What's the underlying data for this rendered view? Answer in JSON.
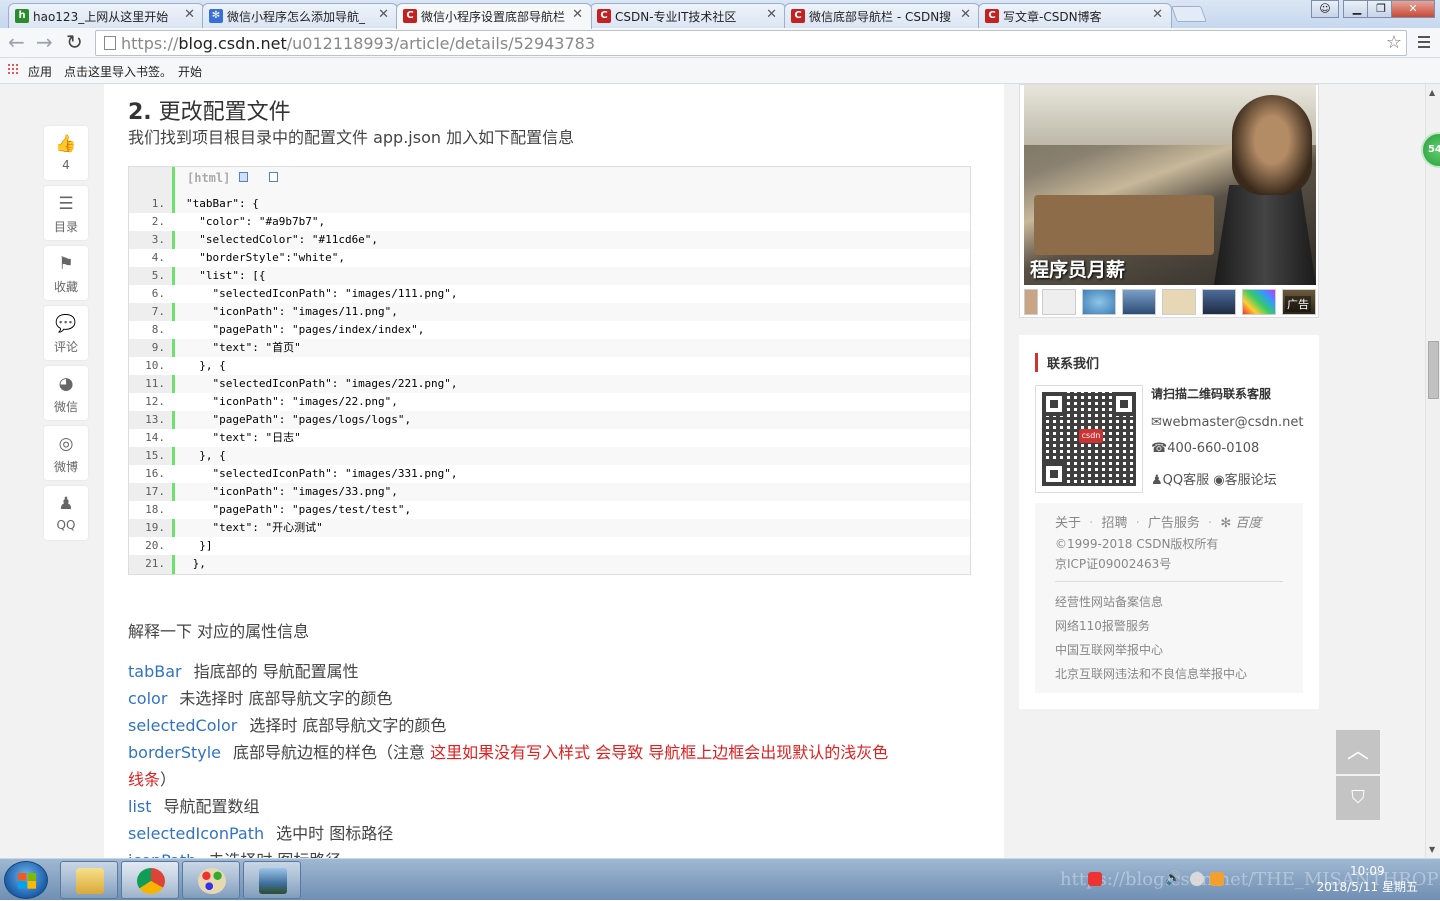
{
  "browser": {
    "tabs": [
      {
        "label": "hao123_上网从这里开始",
        "favicon": "hao123",
        "color": "#2a8c2a"
      },
      {
        "label": "微信小程序怎么添加导航_",
        "favicon": "paw",
        "color": "#3a6fd8"
      },
      {
        "label": "微信小程序设置底部导航栏",
        "favicon": "C",
        "color": "#c32222"
      },
      {
        "label": "CSDN-专业IT技术社区",
        "favicon": "C",
        "color": "#c32222"
      },
      {
        "label": "微信底部导航栏 - CSDN搜",
        "favicon": "C",
        "color": "#c32222"
      },
      {
        "label": "写文章-CSDN博客",
        "favicon": "C",
        "color": "#c32222"
      }
    ],
    "active_tab": 2,
    "url_prefix": "https://",
    "url_host": "blog.csdn.net",
    "url_path": "/u012118993/article/details/52943783",
    "bookmarks": {
      "apps": "应用",
      "import": "点击这里导入书签。",
      "start": "开始"
    },
    "window_controls": [
      "user",
      "minimize",
      "restore",
      "close"
    ]
  },
  "article": {
    "section_num": "2.",
    "section_title": "更改配置文件",
    "intro": "我们找到项目根目录中的配置文件 app.json 加入如下配置信息",
    "code_lang": "[html]",
    "code_lines": [
      "\"tabBar\": {",
      "  \"color\": \"#a9b7b7\",",
      "  \"selectedColor\": \"#11cd6e\",",
      "  \"borderStyle\":\"white\",",
      "  \"list\": [{",
      "    \"selectedIconPath\": \"images/111.png\",",
      "    \"iconPath\": \"images/11.png\",",
      "    \"pagePath\": \"pages/index/index\",",
      "    \"text\": \"首页\"",
      "  }, {",
      "    \"selectedIconPath\": \"images/221.png\",",
      "    \"iconPath\": \"images/22.png\",",
      "    \"pagePath\": \"pages/logs/logs\",",
      "    \"text\": \"日志\"",
      "  }, {",
      "    \"selectedIconPath\": \"images/331.png\",",
      "    \"iconPath\": \"images/33.png\",",
      "    \"pagePath\": \"pages/test/test\",",
      "    \"text\": \"开心测试\"",
      "  }]",
      " },"
    ],
    "explain": "解释一下 对应的属性信息",
    "props": [
      {
        "key": "tabBar",
        "desc": "指底部的 导航配置属性"
      },
      {
        "key": "color",
        "desc": "未选择时 底部导航文字的颜色"
      },
      {
        "key": "selectedColor",
        "desc": "选择时 底部导航文字的颜色"
      },
      {
        "key": "borderStyle",
        "desc": "底部导航边框的样色（注意 ",
        "warn": "这里如果没有写入样式 会导致 导航框上边框会出现默认的浅灰色"
      },
      {
        "key": "list",
        "desc": "导航配置数组"
      },
      {
        "key": "selectedIconPath",
        "desc": "选中时 图标路径"
      },
      {
        "key": "iconPath",
        "desc": "未选择时 图标路径"
      }
    ],
    "warn_tail_1": "线条",
    "warn_tail_2": "）"
  },
  "social": [
    {
      "icon": "thumbs-up-icon",
      "label": "4"
    },
    {
      "icon": "toc-icon",
      "label": "目录"
    },
    {
      "icon": "bookmark-icon",
      "label": "收藏"
    },
    {
      "icon": "comment-icon",
      "label": "评论"
    },
    {
      "icon": "wechat-icon",
      "label": "微信"
    },
    {
      "icon": "weibo-icon",
      "label": "微博"
    },
    {
      "icon": "qq-icon",
      "label": "QQ"
    }
  ],
  "ad": {
    "caption": "程序员月薪",
    "tag": "广告"
  },
  "contact": {
    "title": "联系我们",
    "scan": "请扫描二维码联系客服",
    "email": "webmaster@csdn.net",
    "phone": "400-660-0108",
    "qq": "QQ客服",
    "forum": "客服论坛",
    "qr_logo": "csdn"
  },
  "footer": {
    "links": [
      "关于",
      "招聘",
      "广告服务",
      "百度"
    ],
    "sep": "·",
    "copyright": "©1999-2018 CSDN版权所有",
    "icp": "京ICP证09002463号",
    "records": [
      "经营性网站备案信息",
      "网络110报警服务",
      "中国互联网举报中心",
      "北京互联网违法和不良信息举报中心"
    ]
  },
  "badge": "54",
  "taskbar": {
    "apps": [
      "explorer",
      "chrome",
      "paint",
      "photo-viewer"
    ],
    "watermark": "https://blog.csdn.net/THE_MISANTHROPE",
    "time": "10:09",
    "date": "2018/5/11 星期五"
  }
}
